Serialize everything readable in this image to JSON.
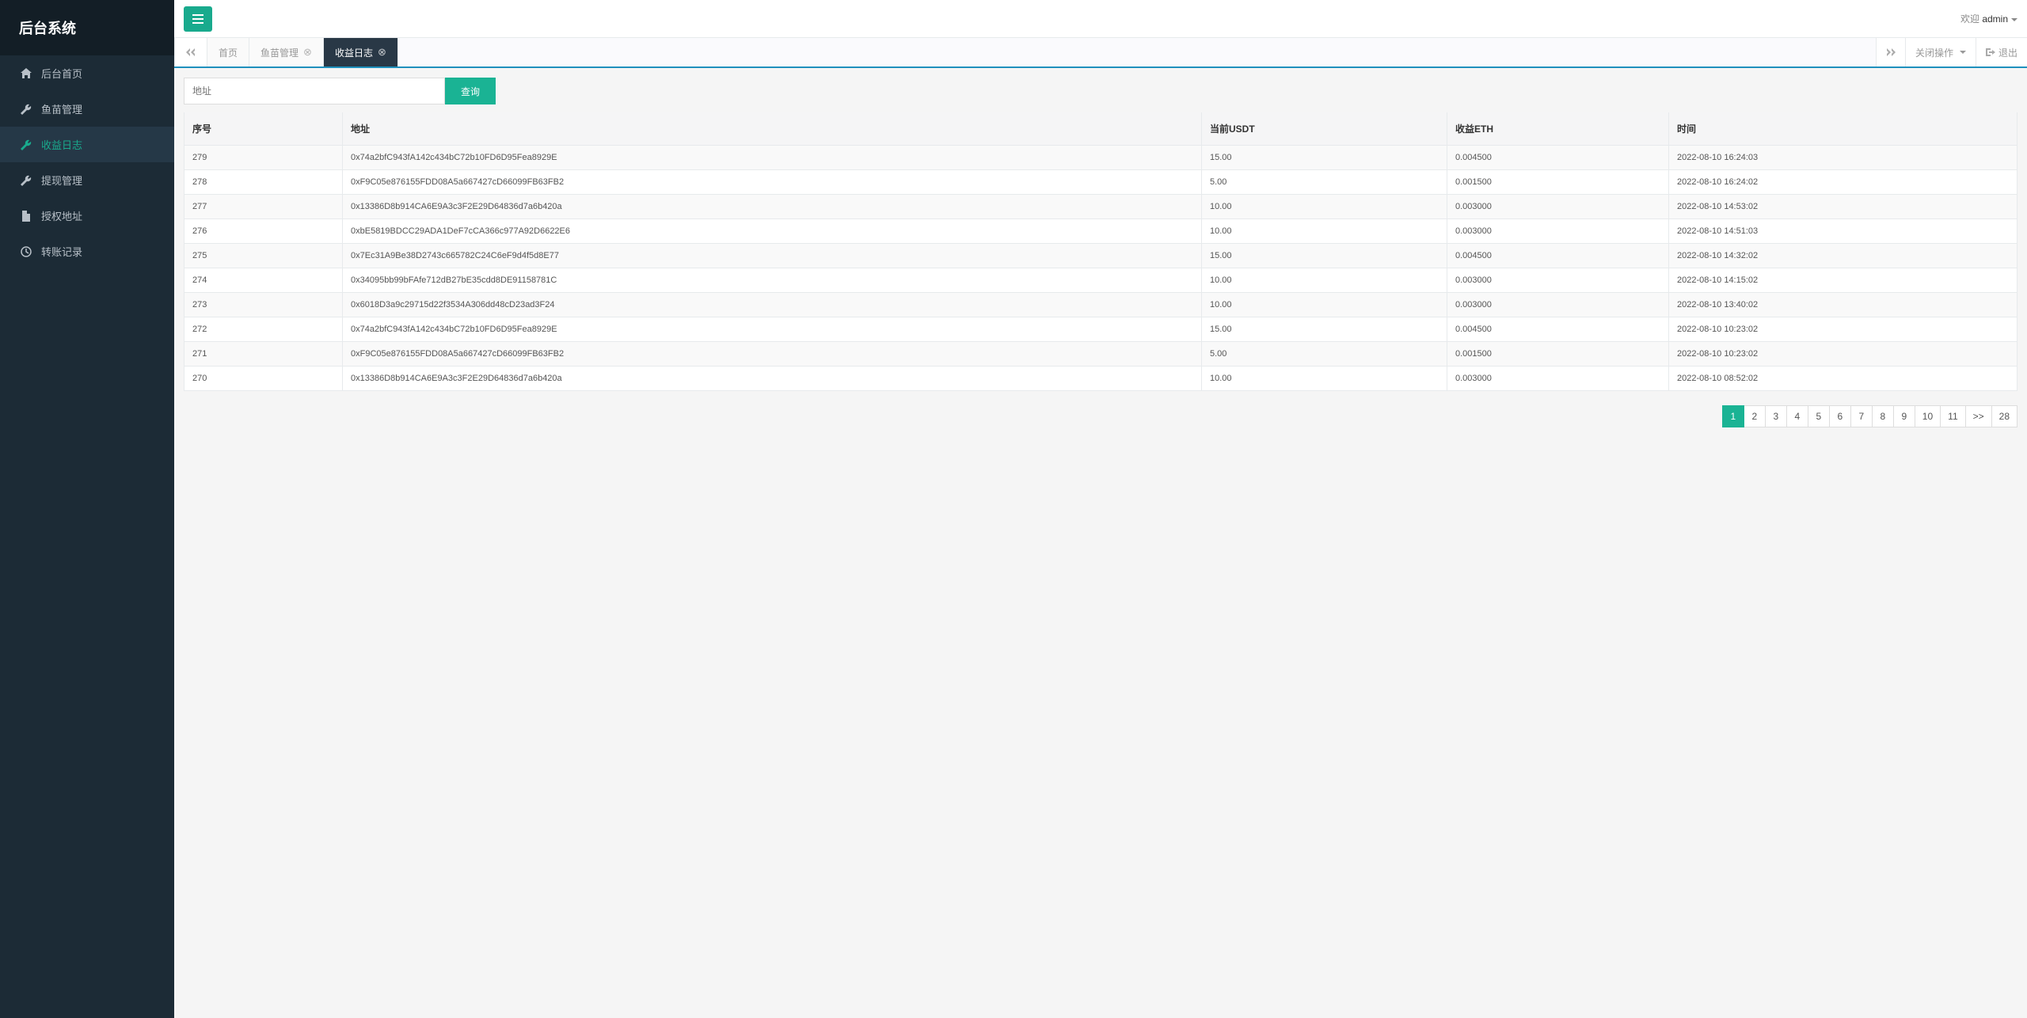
{
  "brand": "后台系统",
  "sidebar": {
    "items": [
      {
        "icon": "home",
        "label": "后台首页"
      },
      {
        "icon": "wrench",
        "label": "鱼苗管理"
      },
      {
        "icon": "wrench",
        "label": "收益日志",
        "active": true
      },
      {
        "icon": "wrench",
        "label": "提现管理"
      },
      {
        "icon": "file",
        "label": "授权地址"
      },
      {
        "icon": "clock",
        "label": "转账记录"
      }
    ]
  },
  "topbar": {
    "welcome_prefix": "欢迎 ",
    "username": "admin"
  },
  "tabs": {
    "items": [
      {
        "label": "首页",
        "closable": false
      },
      {
        "label": "鱼苗管理",
        "closable": true
      },
      {
        "label": "收益日志",
        "closable": true,
        "active": true
      }
    ],
    "close_ops": "关闭操作",
    "exit": "退出"
  },
  "filter": {
    "placeholder": "地址",
    "query_label": "查询"
  },
  "table": {
    "headers": {
      "seq": "序号",
      "addr": "地址",
      "usdt": "当前USDT",
      "eth": "收益ETH",
      "time": "时间"
    },
    "rows": [
      {
        "seq": "279",
        "addr": "0x74a2bfC943fA142c434bC72b10FD6D95Fea8929E",
        "usdt": "15.00",
        "eth": "0.004500",
        "time": "2022-08-10 16:24:03"
      },
      {
        "seq": "278",
        "addr": "0xF9C05e876155FDD08A5a667427cD66099FB63FB2",
        "usdt": "5.00",
        "eth": "0.001500",
        "time": "2022-08-10 16:24:02"
      },
      {
        "seq": "277",
        "addr": "0x13386D8b914CA6E9A3c3F2E29D64836d7a6b420a",
        "usdt": "10.00",
        "eth": "0.003000",
        "time": "2022-08-10 14:53:02"
      },
      {
        "seq": "276",
        "addr": "0xbE5819BDCC29ADA1DeF7cCA366c977A92D6622E6",
        "usdt": "10.00",
        "eth": "0.003000",
        "time": "2022-08-10 14:51:03"
      },
      {
        "seq": "275",
        "addr": "0x7Ec31A9Be38D2743c665782C24C6eF9d4f5d8E77",
        "usdt": "15.00",
        "eth": "0.004500",
        "time": "2022-08-10 14:32:02"
      },
      {
        "seq": "274",
        "addr": "0x34095bb99bFAfe712dB27bE35cdd8DE91158781C",
        "usdt": "10.00",
        "eth": "0.003000",
        "time": "2022-08-10 14:15:02"
      },
      {
        "seq": "273",
        "addr": "0x6018D3a9c29715d22f3534A306dd48cD23ad3F24",
        "usdt": "10.00",
        "eth": "0.003000",
        "time": "2022-08-10 13:40:02"
      },
      {
        "seq": "272",
        "addr": "0x74a2bfC943fA142c434bC72b10FD6D95Fea8929E",
        "usdt": "15.00",
        "eth": "0.004500",
        "time": "2022-08-10 10:23:02"
      },
      {
        "seq": "271",
        "addr": "0xF9C05e876155FDD08A5a667427cD66099FB63FB2",
        "usdt": "5.00",
        "eth": "0.001500",
        "time": "2022-08-10 10:23:02"
      },
      {
        "seq": "270",
        "addr": "0x13386D8b914CA6E9A3c3F2E29D64836d7a6b420a",
        "usdt": "10.00",
        "eth": "0.003000",
        "time": "2022-08-10 08:52:02"
      }
    ]
  },
  "pagination": {
    "pages": [
      "1",
      "2",
      "3",
      "4",
      "5",
      "6",
      "7",
      "8",
      "9",
      "10",
      "11",
      ">>",
      "28"
    ],
    "active": "1"
  }
}
